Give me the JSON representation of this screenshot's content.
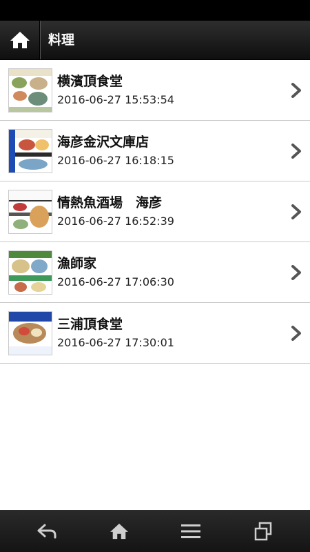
{
  "header": {
    "title": "料理",
    "home_icon": "home-icon"
  },
  "items": [
    {
      "name": "横濱頂食堂",
      "date": "2016-06-27 15:53:54",
      "chevron_icon": "chevron-right-icon"
    },
    {
      "name": "海彦金沢文庫店",
      "date": "2016-06-27 16:18:15",
      "chevron_icon": "chevron-right-icon"
    },
    {
      "name": "情熱魚酒場　海彦",
      "date": "2016-06-27 16:52:39",
      "chevron_icon": "chevron-right-icon"
    },
    {
      "name": "漁師家",
      "date": "2016-06-27 17:06:30",
      "chevron_icon": "chevron-right-icon"
    },
    {
      "name": "三浦頂食堂",
      "date": "2016-06-27 17:30:01",
      "chevron_icon": "chevron-right-icon"
    }
  ],
  "navbar": {
    "icons": [
      "back-icon",
      "home-icon",
      "menu-icon",
      "recent-apps-icon"
    ]
  },
  "colors": {
    "header_bg": "#1a1a1a",
    "statusbar_bg": "#000000",
    "row_border": "#c8c8c8",
    "chevron": "#555555"
  }
}
